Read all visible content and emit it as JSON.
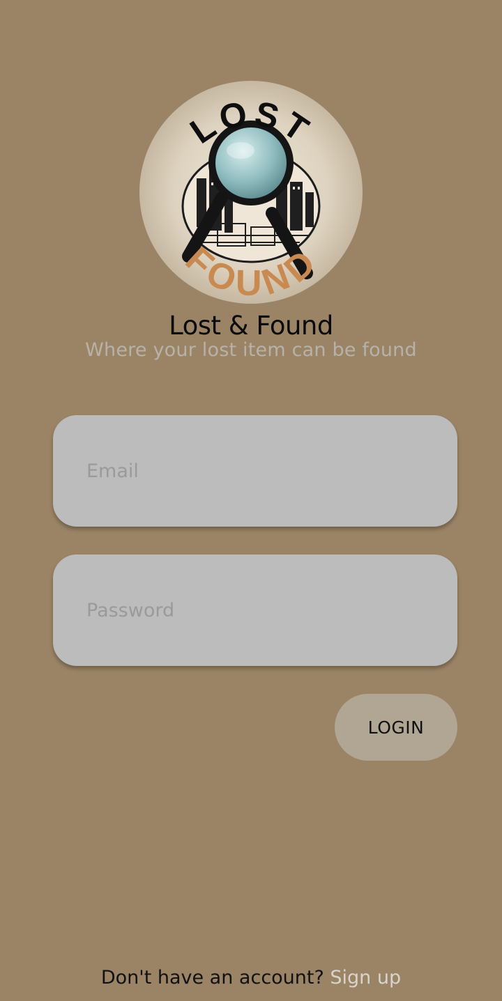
{
  "logo": {
    "top_text": "LOST",
    "bottom_text": "FOUND"
  },
  "app": {
    "title": "Lost & Found",
    "tagline": "Where your lost item can be found"
  },
  "form": {
    "email_placeholder": "Email",
    "email_value": "",
    "password_placeholder": "Password",
    "password_value": "",
    "login_label": "LOGIN"
  },
  "footer": {
    "prompt": "Don't have an account?",
    "signup_label": "Sign up"
  },
  "colors": {
    "background": "#9b8466",
    "field": "#bcbcbc",
    "button": "#b1a594",
    "link": "#d9d4cb",
    "tagline": "#b7b2a8",
    "logo_found": "#c98a52"
  },
  "icons": [
    "magnifying-glass-icon"
  ]
}
